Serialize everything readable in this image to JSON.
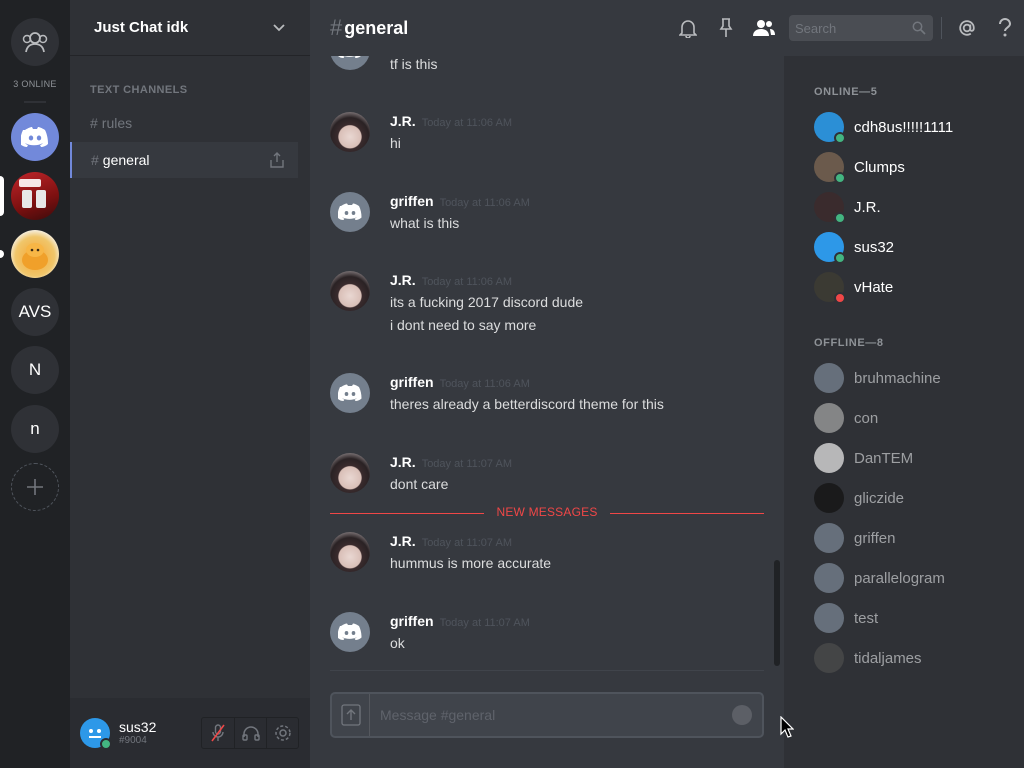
{
  "rail": {
    "online_count": "3 ONLINE",
    "servers": [
      "Discord",
      "YouTube",
      "Pudding",
      "AVS",
      "N",
      "n"
    ]
  },
  "guild": {
    "name": "Just Chat idk",
    "category": "TEXT CHANNELS",
    "channels": [
      "rules",
      "general"
    ]
  },
  "user": {
    "name": "sus32",
    "tag": "#9004"
  },
  "header": {
    "hash": "#",
    "channel": "general",
    "search_placeholder": "Search"
  },
  "messages": [
    {
      "author": "",
      "time": "",
      "lines": [
        "tf is this"
      ],
      "avatar": "discord"
    },
    {
      "author": "J.R.",
      "time": "Today at 11:06 AM",
      "lines": [
        "hi"
      ],
      "avatar": "jr"
    },
    {
      "author": "griffen",
      "time": "Today at 11:06 AM",
      "lines": [
        "what is this"
      ],
      "avatar": "discord"
    },
    {
      "author": "J.R.",
      "time": "Today at 11:06 AM",
      "lines": [
        "its a fucking 2017 discord dude",
        "i dont need to say more"
      ],
      "avatar": "jr"
    },
    {
      "author": "griffen",
      "time": "Today at 11:06 AM",
      "lines": [
        "theres already a betterdiscord theme for this"
      ],
      "avatar": "discord"
    },
    {
      "author": "J.R.",
      "time": "Today at 11:07 AM",
      "lines": [
        "dont care"
      ],
      "avatar": "jr"
    },
    {
      "author": "J.R.",
      "time": "Today at 11:07 AM",
      "lines": [
        "hummus is more accurate"
      ],
      "avatar": "jr"
    },
    {
      "author": "griffen",
      "time": "Today at 11:07 AM",
      "lines": [
        "ok"
      ],
      "avatar": "discord"
    }
  ],
  "new_messages_label": "NEW MESSAGES",
  "composer": {
    "placeholder": "Message #general"
  },
  "members": {
    "online_label": "ONLINE—5",
    "offline_label": "OFFLINE—8",
    "online": [
      {
        "name": "cdh8us!!!!!1111",
        "status": "online",
        "color": "#2b8fd6"
      },
      {
        "name": "Clumps",
        "status": "online",
        "color": "#6b5a4c"
      },
      {
        "name": "J.R.",
        "status": "online",
        "color": "#3a2b2d"
      },
      {
        "name": "sus32",
        "status": "online",
        "color": "#2d98e8"
      },
      {
        "name": "vHate",
        "status": "dnd",
        "color": "#3b3a33"
      }
    ],
    "offline": [
      {
        "name": "bruhmachine",
        "color": "#747f8d"
      },
      {
        "name": "con",
        "color": "#9a9a9a"
      },
      {
        "name": "DanTEM",
        "color": "#d9d9d9"
      },
      {
        "name": "gliczide",
        "color": "#151515"
      },
      {
        "name": "griffen",
        "color": "#747f8d"
      },
      {
        "name": "parallelogram",
        "color": "#747f8d"
      },
      {
        "name": "test",
        "color": "#747f8d"
      },
      {
        "name": "tidaljames",
        "color": "#4a4a4a"
      }
    ]
  }
}
